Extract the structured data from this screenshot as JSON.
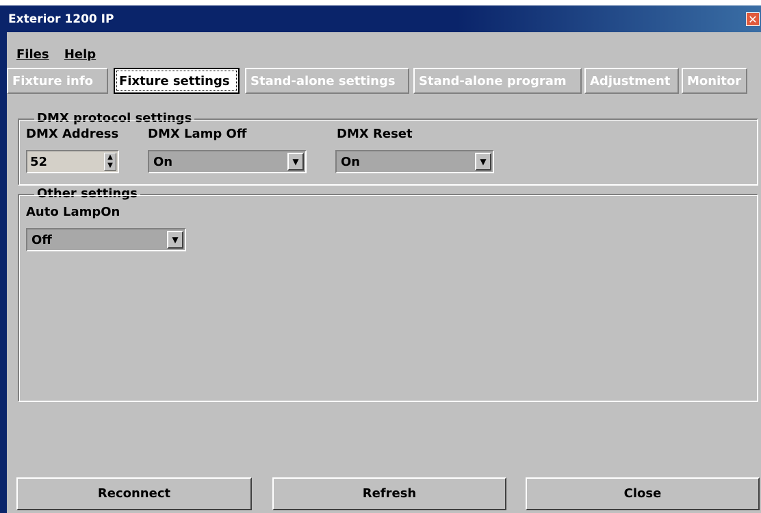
{
  "window": {
    "title": "Exterior 1200 IP",
    "close_glyph": "✕"
  },
  "menu": {
    "files": "Files",
    "help": "Help"
  },
  "tabs": [
    {
      "label": "Fixture info"
    },
    {
      "label": "Fixture settings"
    },
    {
      "label": "Stand-alone settings"
    },
    {
      "label": "Stand-alone program"
    },
    {
      "label": "Adjustment"
    },
    {
      "label": "Monitor"
    }
  ],
  "dmx": {
    "legend": "DMX protocol settings",
    "address_label": "DMX Address",
    "address_value": "52",
    "lamp_off_label": "DMX Lamp Off",
    "lamp_off_value": "On",
    "reset_label": "DMX Reset",
    "reset_value": "On"
  },
  "other": {
    "legend": "Other settings",
    "auto_lamp_label": "Auto LampOn",
    "auto_lamp_value": "Off"
  },
  "buttons": {
    "reconnect": "Reconnect",
    "refresh": "Refresh",
    "close": "Close"
  },
  "icons": {
    "spinner": "updown-arrows-icon",
    "dropdown": "chevron-down-icon"
  }
}
